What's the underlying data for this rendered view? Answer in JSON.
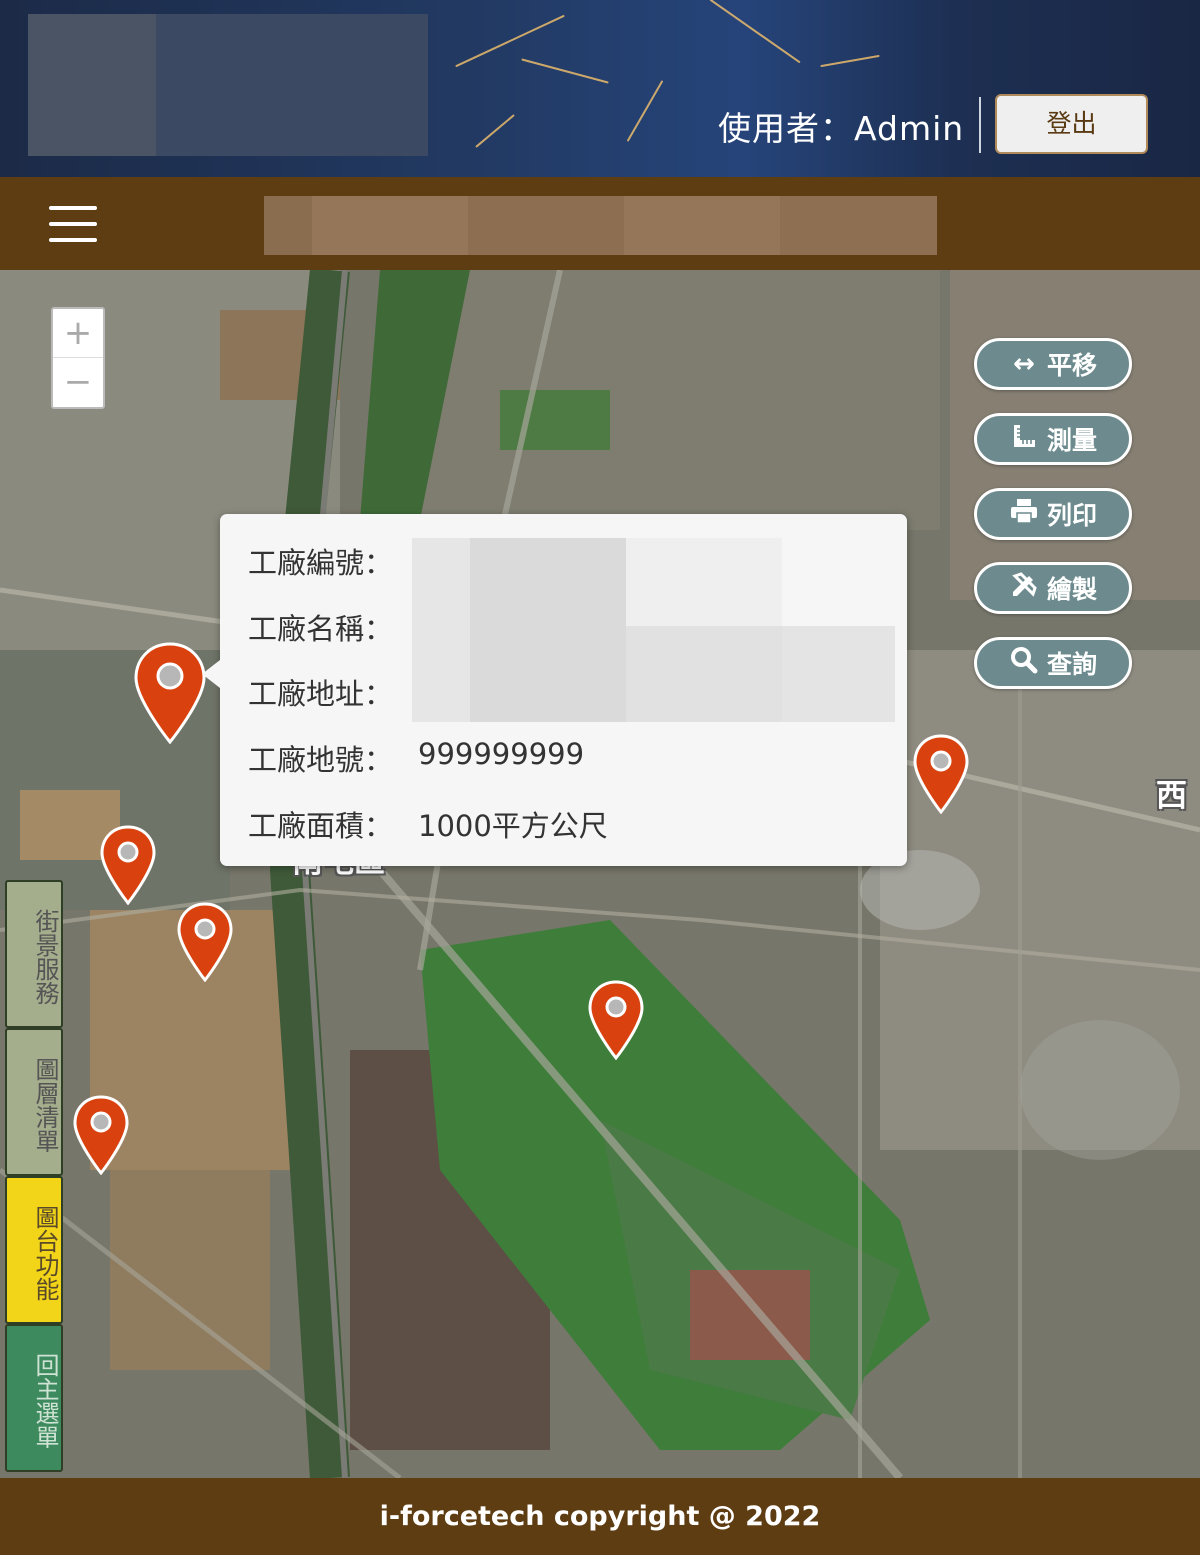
{
  "header": {
    "user_label": "使用者：Admin",
    "logout_label": "登出"
  },
  "nav": {
    "menu_icon": "hamburger-menu-icon"
  },
  "map": {
    "zoom_in": "+",
    "zoom_out": "−",
    "tools": [
      {
        "label": "平移",
        "icon": "pan-arrows-icon"
      },
      {
        "label": "測量",
        "icon": "ruler-icon"
      },
      {
        "label": "列印",
        "icon": "printer-icon"
      },
      {
        "label": "繪製",
        "icon": "draw-tools-icon"
      },
      {
        "label": "查詢",
        "icon": "search-icon"
      }
    ],
    "place_labels": {
      "district": "南屯區",
      "east_edge": "西"
    },
    "popup": {
      "factory_id_label": "工廠編號：",
      "factory_name_label": "工廠名稱：",
      "factory_address_label": "工廠地址：",
      "land_number_label": "工廠地號：",
      "land_number_value": "999999999",
      "area_label": "工廠面積：",
      "area_value": "1000平方公尺"
    },
    "side_tabs": [
      {
        "label": "街景服務",
        "color": "#a4ad8c"
      },
      {
        "label": "圖層清單",
        "color": "#a4ad8c"
      },
      {
        "label": "圖台功能",
        "color": "#f2d418"
      },
      {
        "label": "回主選單",
        "color": "#3d8a5e"
      }
    ],
    "marker_color": "#d9420f"
  },
  "footer": {
    "copyright": "i-forcetech copyright @ 2022"
  }
}
